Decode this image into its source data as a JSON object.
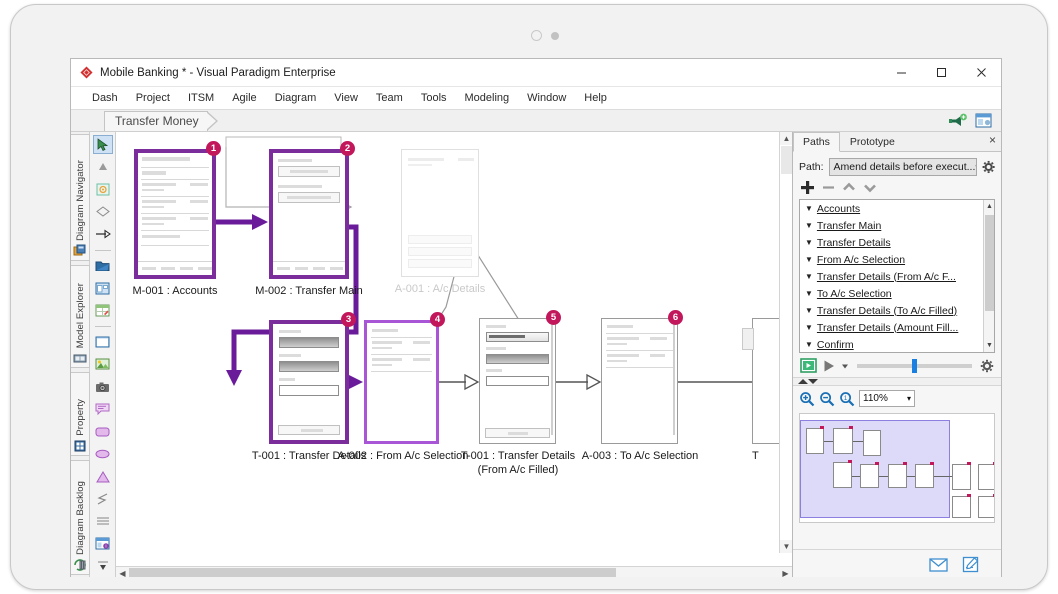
{
  "window": {
    "title": "Mobile Banking * - Visual Paradigm Enterprise",
    "logo_icon": "visual-paradigm-diamond-icon",
    "minimize_label": "minimize-icon",
    "maximize_label": "maximize-icon",
    "close_label": "close-icon"
  },
  "menu": {
    "items": [
      {
        "label": "Dash"
      },
      {
        "label": "Project"
      },
      {
        "label": "ITSM"
      },
      {
        "label": "Agile"
      },
      {
        "label": "Diagram"
      },
      {
        "label": "View"
      },
      {
        "label": "Team"
      },
      {
        "label": "Tools"
      },
      {
        "label": "Modeling"
      },
      {
        "label": "Window"
      },
      {
        "label": "Help"
      }
    ]
  },
  "tabstrip": {
    "breadcrumb": "Transfer Money",
    "icons": [
      "announce-icon",
      "panel-layout-icon"
    ]
  },
  "rail": {
    "tabs": [
      {
        "label": "Diagram Navigator",
        "icon": "diagram-navigator-icon"
      },
      {
        "label": "Model Explorer",
        "icon": "model-explorer-icon"
      },
      {
        "label": "Property",
        "icon": "property-icon"
      },
      {
        "label": "Diagram Backlog",
        "icon": "backlog-icon"
      }
    ]
  },
  "palette": {
    "tools": [
      {
        "name": "pointer-tool",
        "selected": true
      },
      {
        "name": "triangle-tool",
        "selected": false
      },
      {
        "name": "sun-gear-tool",
        "selected": false
      },
      {
        "name": "diamond-tool",
        "selected": false
      },
      {
        "name": "arrow-tool",
        "selected": false
      },
      {
        "name": "folder-tool",
        "selected": false
      },
      {
        "name": "window-tool",
        "selected": false
      },
      {
        "name": "table-tool",
        "selected": false
      },
      {
        "name": "rectangle-tool",
        "selected": false
      },
      {
        "name": "image-tool",
        "selected": false
      },
      {
        "name": "camera-tool",
        "selected": false
      },
      {
        "name": "comment-tool",
        "selected": false
      },
      {
        "name": "rounded-rect-tool",
        "selected": false
      },
      {
        "name": "ellipse-tool",
        "selected": false
      },
      {
        "name": "triangle-shape-tool",
        "selected": false
      },
      {
        "name": "zigzag-tool",
        "selected": false
      },
      {
        "name": "lines-tool",
        "selected": false
      },
      {
        "name": "info-window-tool",
        "selected": false
      },
      {
        "name": "dropdown-more-tool",
        "selected": false
      }
    ]
  },
  "canvas": {
    "nodes": [
      {
        "badge": "1",
        "label": "M-001 : Accounts",
        "state": "active"
      },
      {
        "badge": "2",
        "label": "M-002 : Transfer Main",
        "state": "active"
      },
      {
        "badge": "",
        "label": "A-001 : A/c Details",
        "state": "ghost"
      },
      {
        "badge": "3",
        "label": "T-001 : Transfer Details",
        "state": "active"
      },
      {
        "badge": "4",
        "label": "A-002 : From A/c Selection",
        "state": "active2"
      },
      {
        "badge": "5",
        "label": "T-001 : Transfer Details",
        "label2": "(From A/c Filled)",
        "state": "plain"
      },
      {
        "badge": "6",
        "label": "A-003 : To A/c Selection",
        "state": "plain"
      },
      {
        "badge": "",
        "label": "T",
        "state": "cut"
      }
    ],
    "hscroll_value": 72,
    "accent_active": "#7b2d9b",
    "accent_active2": "#a855d6",
    "badge_color": "#c2185b"
  },
  "dock": {
    "tabs": [
      {
        "label": "Paths",
        "active": true
      },
      {
        "label": "Prototype",
        "active": false
      }
    ],
    "close_icon": "close-icon",
    "path_label": "Path:",
    "path_value": "Amend details before execut...",
    "settings_icon": "gear-icon",
    "buttons": [
      {
        "name": "add-path-button",
        "glyph": "+"
      },
      {
        "name": "remove-path-button",
        "glyph": "−"
      },
      {
        "name": "move-up-button",
        "glyph": "▲"
      },
      {
        "name": "move-down-button",
        "glyph": "▼"
      }
    ],
    "path_items": [
      {
        "label": "Accounts"
      },
      {
        "label": "Transfer Main"
      },
      {
        "label": "Transfer Details"
      },
      {
        "label": "From A/c Selection"
      },
      {
        "label": "Transfer Details (From A/c F..."
      },
      {
        "label": "To A/c Selection"
      },
      {
        "label": "Transfer Details (To A/c Filled)"
      },
      {
        "label": "Transfer Details (Amount Fill..."
      },
      {
        "label": "Confirm"
      }
    ],
    "player": {
      "record_icon": "filmstrip-icon",
      "play_icon": "play-icon",
      "dropdown_icon": "caret-down-icon",
      "settings_icon": "gear-icon",
      "slider_value": 48
    },
    "zoom": {
      "zoom_in_icon": "zoom-in-icon",
      "zoom_out_icon": "zoom-out-icon",
      "zoom_reset_icon": "zoom-actual-icon",
      "level": "110%"
    },
    "footer_icons": [
      "mail-icon",
      "note-edit-icon"
    ]
  }
}
